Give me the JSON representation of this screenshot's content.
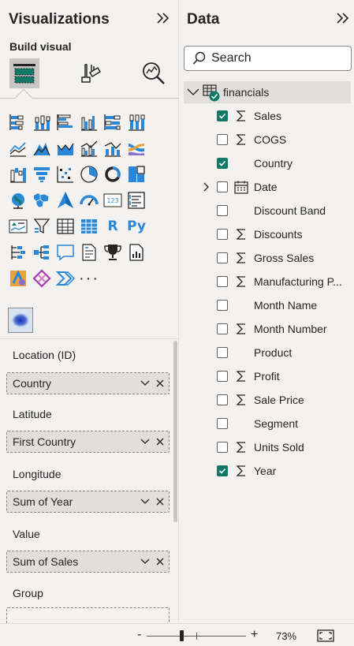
{
  "visualizations": {
    "title": "Visualizations",
    "build_visual_label": "Build visual",
    "mode_buttons": [
      "build-visual",
      "format-visual",
      "analytics"
    ],
    "gallery_rows": [
      [
        "stacked-bar-icon",
        "stacked-column-icon",
        "clustered-bar-icon",
        "clustered-column-icon",
        "100-stacked-bar-icon",
        "100-stacked-column-icon"
      ],
      [
        "line-chart-icon",
        "area-chart-icon",
        "stacked-area-icon",
        "line-clustered-column-icon",
        "line-stacked-column-icon",
        "ribbon-chart-icon"
      ],
      [
        "waterfall-icon",
        "funnel-icon",
        "scatter-icon",
        "pie-chart-icon",
        "donut-chart-icon",
        "treemap-icon"
      ],
      [
        "map-icon",
        "filled-map-icon",
        "azure-map-icon",
        "gauge-icon",
        "card-icon",
        "multi-row-card-icon"
      ],
      [
        "kpi-icon",
        "slicer-icon",
        "table-icon",
        "matrix-icon",
        "r-visual-icon",
        "python-visual-icon"
      ],
      [
        "key-influencers-icon",
        "decomposition-tree-icon",
        "qa-icon",
        "smart-narrative-icon",
        "goals-icon",
        "paginated-report-icon"
      ],
      [
        "power-apps-icon",
        "power-automate-icon",
        "power-automate-flow-icon",
        "more-visuals-icon"
      ]
    ],
    "r_label": "R",
    "py_label": "Py",
    "more_label": "···",
    "wells": [
      {
        "label": "Location (ID)",
        "field": "Country"
      },
      {
        "label": "Latitude",
        "field": "First Country"
      },
      {
        "label": "Longitude",
        "field": "Sum of Year"
      },
      {
        "label": "Value",
        "field": "Sum of Sales"
      },
      {
        "label": "Group",
        "field": ""
      }
    ]
  },
  "data": {
    "title": "Data",
    "search_placeholder": "Search",
    "table": {
      "name": "financials"
    },
    "fields": [
      {
        "name": "Sales",
        "checked": true,
        "type": "sigma"
      },
      {
        "name": "COGS",
        "checked": false,
        "type": "sigma"
      },
      {
        "name": "Country",
        "checked": true,
        "type": "text"
      },
      {
        "name": "Date",
        "checked": false,
        "type": "date",
        "expandable": true
      },
      {
        "name": "Discount Band",
        "checked": false,
        "type": "text"
      },
      {
        "name": "Discounts",
        "checked": false,
        "type": "sigma"
      },
      {
        "name": "Gross Sales",
        "checked": false,
        "type": "sigma"
      },
      {
        "name": "Manufacturing P...",
        "checked": false,
        "type": "sigma"
      },
      {
        "name": "Month Name",
        "checked": false,
        "type": "text"
      },
      {
        "name": "Month Number",
        "checked": false,
        "type": "sigma"
      },
      {
        "name": "Product",
        "checked": false,
        "type": "text"
      },
      {
        "name": "Profit",
        "checked": false,
        "type": "sigma"
      },
      {
        "name": "Sale Price",
        "checked": false,
        "type": "sigma"
      },
      {
        "name": "Segment",
        "checked": false,
        "type": "text"
      },
      {
        "name": "Units Sold",
        "checked": false,
        "type": "sigma"
      },
      {
        "name": "Year",
        "checked": true,
        "type": "sigma"
      }
    ]
  },
  "status": {
    "zoom_minus": "-",
    "zoom_plus": "+",
    "zoom_percent": "73%",
    "zoom_value": 0.73
  },
  "colors": {
    "accent_blue": "#118dff",
    "check_green": "#117865",
    "icon_blue": "#2b88d8"
  }
}
